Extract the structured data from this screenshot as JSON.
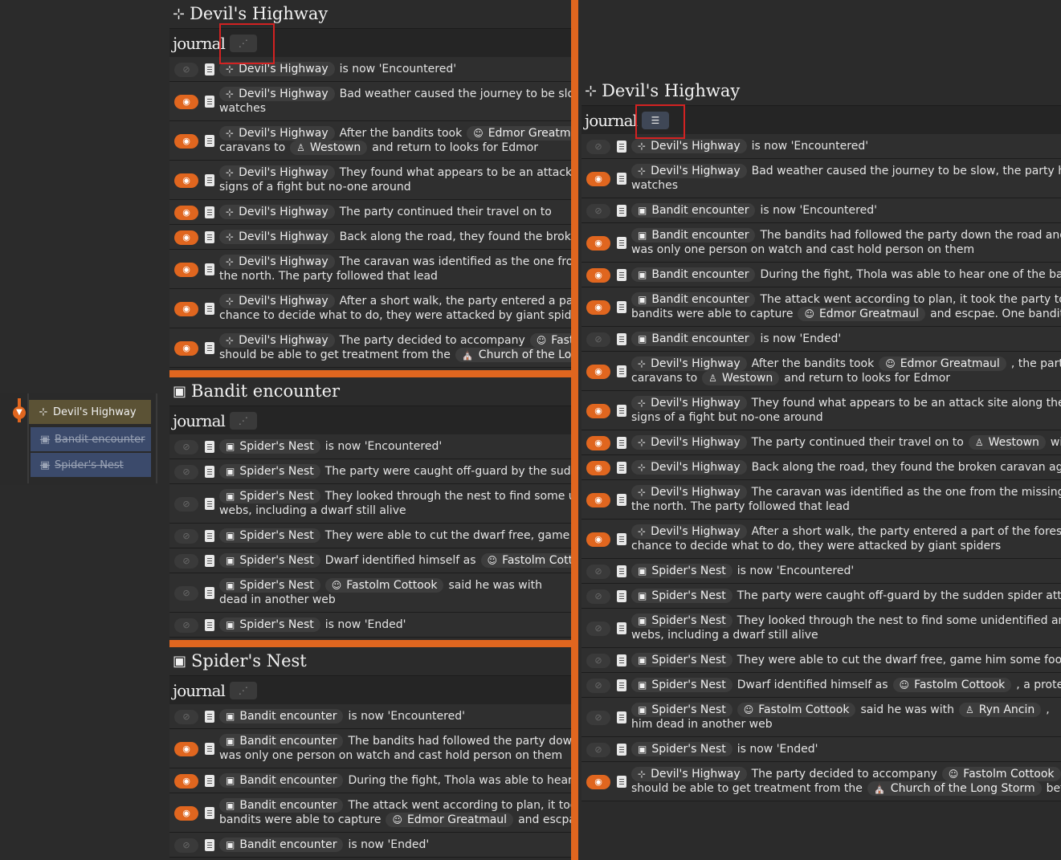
{
  "sidebar": {
    "items": [
      {
        "label": "Devil's Highway",
        "icon": "signpost-icon"
      },
      {
        "label": "Bandit encounter",
        "icon": "image-icon"
      },
      {
        "label": "Spider's Nest",
        "icon": "image-icon"
      }
    ]
  },
  "left": {
    "journal_label": "journal",
    "sections": [
      {
        "title": "Devil's Highway",
        "icon": "signpost-icon",
        "rows": [
          {
            "eye": false,
            "chip": "Devil's Highway",
            "chip_icon": "signpost-icon",
            "text": "is now 'Encountered'",
            "line2": ""
          },
          {
            "eye": true,
            "chip": "Devil's Highway",
            "chip_icon": "signpost-icon",
            "text": "Bad weather caused the journey to be slow",
            "line2": "watches"
          },
          {
            "eye": true,
            "chip": "Devil's Highway",
            "chip_icon": "signpost-icon",
            "text": "After the bandits took",
            "chip2": "Edmor Greatm",
            "chip2_icon": "smiley-icon",
            "line2": "caravans to",
            "l2chip": "Westown",
            "l2chip_icon": "person-icon",
            "l2text": "and return to looks for Edmor"
          },
          {
            "eye": true,
            "chip": "Devil's Highway",
            "chip_icon": "signpost-icon",
            "text": "They found what appears to be an attack si",
            "line2": "signs of a fight but no-one around"
          },
          {
            "eye": true,
            "chip": "Devil's Highway",
            "chip_icon": "signpost-icon",
            "text": "The party continued their travel on to",
            "line2": ""
          },
          {
            "eye": true,
            "chip": "Devil's Highway",
            "chip_icon": "signpost-icon",
            "text": "Back along the road, they found the broker",
            "line2": ""
          },
          {
            "eye": true,
            "chip": "Devil's Highway",
            "chip_icon": "signpost-icon",
            "text": "The caravan was identified as the one from",
            "line2": "the north. The party followed that lead"
          },
          {
            "eye": true,
            "chip": "Devil's Highway",
            "chip_icon": "signpost-icon",
            "text": "After a short walk, the party entered a part",
            "line2": "chance to decide what to do, they were attacked by giant spiders"
          },
          {
            "eye": true,
            "chip": "Devil's Highway",
            "chip_icon": "signpost-icon",
            "text": "The party decided to accompany",
            "chip2": "Fast",
            "chip2_icon": "smiley-icon",
            "line2": "should be able to get treatment from the",
            "l2chip": "Church of the Long",
            "l2chip_icon": "church-icon",
            "l2text": ""
          }
        ]
      },
      {
        "title": "Bandit encounter",
        "icon": "image-icon",
        "rows": [
          {
            "eye": false,
            "chip": "Spider's Nest",
            "chip_icon": "image-icon",
            "text": "is now 'Encountered'",
            "line2": ""
          },
          {
            "eye": false,
            "chip": "Spider's Nest",
            "chip_icon": "image-icon",
            "text": "The party were caught off-guard by the sudde",
            "line2": ""
          },
          {
            "eye": false,
            "chip": "Spider's Nest",
            "chip_icon": "image-icon",
            "text": "They looked through the nest to find some ur",
            "line2": "webs, including a dwarf still alive"
          },
          {
            "eye": false,
            "chip": "Spider's Nest",
            "chip_icon": "image-icon",
            "text": "They were able to cut the dwarf free, game hi",
            "line2": ""
          },
          {
            "eye": false,
            "chip": "Spider's Nest",
            "chip_icon": "image-icon",
            "text": "Dwarf identified himself as",
            "chip2": "Fastolm Cott",
            "chip2_icon": "smiley-icon",
            "line2": ""
          },
          {
            "eye": false,
            "chip": "Spider's Nest",
            "chip_icon": "image-icon",
            "text": "",
            "chip2": "Fastolm Cottook",
            "chip2_icon": "smiley-icon",
            "text2": "said he was with",
            "line2": "dead in another web"
          },
          {
            "eye": false,
            "chip": "Spider's Nest",
            "chip_icon": "image-icon",
            "text": "is now 'Ended'",
            "line2": ""
          }
        ]
      },
      {
        "title": "Spider's Nest",
        "icon": "image-icon",
        "rows": [
          {
            "eye": false,
            "chip": "Bandit encounter",
            "chip_icon": "image-icon",
            "text": "is now 'Encountered'",
            "line2": ""
          },
          {
            "eye": true,
            "chip": "Bandit encounter",
            "chip_icon": "image-icon",
            "text": "The bandits had followed the party down",
            "line2": "was only one person on watch and cast hold person on them"
          },
          {
            "eye": true,
            "chip": "Bandit encounter",
            "chip_icon": "image-icon",
            "text": "During the fight, Thola was able to hear o",
            "line2": ""
          },
          {
            "eye": true,
            "chip": "Bandit encounter",
            "chip_icon": "image-icon",
            "text": "The attack went according to plan, it took",
            "line2": "bandits were able to capture",
            "l2chip": "Edmor Greatmaul",
            "l2chip_icon": "smiley-icon",
            "l2text": "and escpae."
          },
          {
            "eye": false,
            "chip": "Bandit encounter",
            "chip_icon": "image-icon",
            "text": "is now 'Ended'",
            "line2": ""
          }
        ]
      }
    ]
  },
  "right": {
    "title": "Devil's Highway",
    "journal_label": "journal",
    "rows": [
      {
        "eye": false,
        "chip": "Devil's Highway",
        "chip_icon": "signpost-icon",
        "text": "is now 'Encountered'",
        "line2": ""
      },
      {
        "eye": true,
        "chip": "Devil's Highway",
        "chip_icon": "signpost-icon",
        "text": "Bad weather caused the journey to be slow, the party had",
        "line2": "watches"
      },
      {
        "eye": false,
        "chip": "Bandit encounter",
        "chip_icon": "image-icon",
        "text": "is now 'Encountered'",
        "line2": ""
      },
      {
        "eye": true,
        "chip": "Bandit encounter",
        "chip_icon": "image-icon",
        "text": "The bandits had followed the party down the road and c",
        "line2": "was only one person on watch and cast hold person on them"
      },
      {
        "eye": true,
        "chip": "Bandit encounter",
        "chip_icon": "image-icon",
        "text": "During the fight, Thola was able to hear one of the band",
        "line2": ""
      },
      {
        "eye": true,
        "chip": "Bandit encounter",
        "chip_icon": "image-icon",
        "text": "The attack went according to plan, it took the party too",
        "line2": "bandits were able to capture",
        "l2chip": "Edmor Greatmaul",
        "l2chip_icon": "smiley-icon",
        "l2text": "and escpae. One bandit wa"
      },
      {
        "eye": false,
        "chip": "Bandit encounter",
        "chip_icon": "image-icon",
        "text": "is now 'Ended'",
        "line2": ""
      },
      {
        "eye": true,
        "chip": "Devil's Highway",
        "chip_icon": "signpost-icon",
        "text": "After the bandits took",
        "chip2": "Edmor Greatmaul",
        "chip2_icon": "smiley-icon",
        "text2": ", the party",
        "line2": "caravans to",
        "l2chip": "Westown",
        "l2chip_icon": "person-icon",
        "l2text": "and return to looks for Edmor"
      },
      {
        "eye": true,
        "chip": "Devil's Highway",
        "chip_icon": "signpost-icon",
        "text": "They found what appears to be an attack site along the ro",
        "line2": "signs of a fight but no-one around"
      },
      {
        "eye": true,
        "chip": "Devil's Highway",
        "chip_icon": "signpost-icon",
        "text": "The party continued their travel on to",
        "chip2": "Westown",
        "chip2_icon": "person-icon",
        "text2": "wi",
        "line2": ""
      },
      {
        "eye": true,
        "chip": "Devil's Highway",
        "chip_icon": "signpost-icon",
        "text": "Back along the road, they found the broken caravan again",
        "line2": ""
      },
      {
        "eye": true,
        "chip": "Devil's Highway",
        "chip_icon": "signpost-icon",
        "text": "The caravan was identified as the one from the missing sl",
        "line2": "the north. The party followed that lead"
      },
      {
        "eye": true,
        "chip": "Devil's Highway",
        "chip_icon": "signpost-icon",
        "text": "After a short walk, the party entered a part of the forest th",
        "line2": "chance to decide what to do, they were attacked by giant spiders"
      },
      {
        "eye": false,
        "chip": "Spider's Nest",
        "chip_icon": "image-icon",
        "text": "is now 'Encountered'",
        "line2": ""
      },
      {
        "eye": false,
        "chip": "Spider's Nest",
        "chip_icon": "image-icon",
        "text": "The party were caught off-guard by the sudden spider attack",
        "line2": ""
      },
      {
        "eye": false,
        "chip": "Spider's Nest",
        "chip_icon": "image-icon",
        "text": "They looked through the nest to find some unidentified anin",
        "line2": "webs, including a dwarf still alive"
      },
      {
        "eye": false,
        "chip": "Spider's Nest",
        "chip_icon": "image-icon",
        "text": "They were able to cut the dwarf free, game him some food,",
        "line2": ""
      },
      {
        "eye": false,
        "chip": "Spider's Nest",
        "chip_icon": "image-icon",
        "text": "Dwarf identified himself as",
        "chip2": "Fastolm Cottook",
        "chip2_icon": "smiley-icon",
        "text2": ", a prote",
        "line2": ""
      },
      {
        "eye": false,
        "chip": "Spider's Nest",
        "chip_icon": "image-icon",
        "text": "",
        "chip2": "Fastolm Cottook",
        "chip2_icon": "smiley-icon",
        "text2": "said he was with",
        "chip3": "Ryn Ancin",
        "chip3_icon": "person-icon",
        "text3": ",",
        "line2": "him dead in another web"
      },
      {
        "eye": false,
        "chip": "Spider's Nest",
        "chip_icon": "image-icon",
        "text": "is now 'Ended'",
        "line2": ""
      },
      {
        "eye": true,
        "chip": "Devil's Highway",
        "chip_icon": "signpost-icon",
        "text": "The party decided to accompany",
        "chip2": "Fastolm Cottook",
        "chip2_icon": "smiley-icon",
        "line2": "should be able to get treatment from the",
        "l2chip": "Church of the Long Storm",
        "l2chip_icon": "church-icon",
        "l2text": "befor"
      }
    ]
  },
  "colors": {
    "accent": "#e0661f",
    "selected": "#5b5235",
    "child_bg": "#3b4a6b",
    "highlight_box": "#d32222"
  }
}
